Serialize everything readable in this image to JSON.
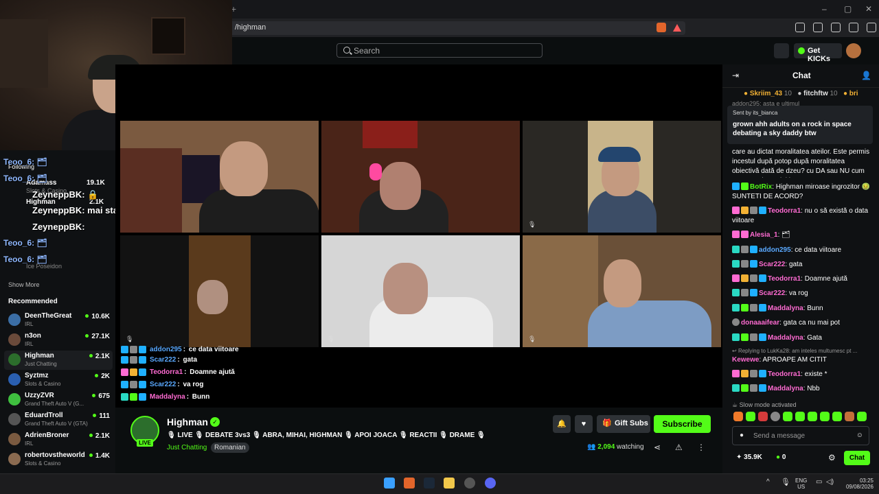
{
  "browser": {
    "tab_plus": "+",
    "url": "/highman",
    "window_controls": [
      "–",
      "▢",
      "✕"
    ]
  },
  "nav": {
    "search_placeholder": "Search",
    "get_kicks": "Get KICKs"
  },
  "stream_overlay_chat_left": [
    {
      "text": "Teoo_6: 🗂",
      "style": "blue"
    },
    {
      "text": "Teoo_6: 🗂",
      "style": "blue"
    },
    {
      "text": "ZeyneppBK: 🔒",
      "style": "big"
    },
    {
      "text": "ZeyneppBK: mai stai?",
      "style": "big"
    },
    {
      "text": "ZeyneppBK:",
      "style": "big"
    },
    {
      "text": "Teoo_6: 🗂",
      "style": "blue"
    },
    {
      "text": "Teoo_6: 🗂",
      "style": "blue"
    }
  ],
  "sidebar": {
    "following_label": "Following",
    "following_items": [
      {
        "name": "Adamass",
        "game": "Slots & Casino",
        "viewers": "19.1K"
      },
      {
        "name": "Highman",
        "game": "",
        "viewers": "2.1K"
      },
      {
        "name": "Ice Poseidon",
        "game": "",
        "viewers": ""
      }
    ],
    "show_more": "Show More",
    "recommended_label": "Recommended",
    "recommended": [
      {
        "name": "DeenTheGreat",
        "game": "IRL",
        "viewers": "10.6K",
        "color": "#3b6ea5"
      },
      {
        "name": "n3on",
        "game": "IRL",
        "viewers": "27.1K",
        "color": "#6a4a3a"
      },
      {
        "name": "Highman",
        "game": "Just Chatting",
        "viewers": "2.1K",
        "color": "#2c6e2c"
      },
      {
        "name": "Syztmz",
        "game": "Slots & Casino",
        "viewers": "2K",
        "color": "#2a5fb0"
      },
      {
        "name": "UzzyZVR",
        "game": "Grand Theft Auto V (G...",
        "viewers": "675",
        "color": "#3fbf3f"
      },
      {
        "name": "EduardTroll",
        "game": "Grand Theft Auto V (GTA)",
        "viewers": "111",
        "color": "#555"
      },
      {
        "name": "AdrienBroner",
        "game": "IRL",
        "viewers": "2.1K",
        "color": "#7a5a40"
      },
      {
        "name": "robertovstheworld",
        "game": "Slots & Casino",
        "viewers": "1.4K",
        "color": "#8a6a50"
      }
    ]
  },
  "video_chat_overlay": [
    {
      "name": "addon295",
      "msg": "ce data viitoare",
      "color": "#5aa9ff"
    },
    {
      "name": "Scar222",
      "msg": "gata",
      "color": "#5aa9ff"
    },
    {
      "name": "Teodorra1",
      "msg": "Doamne ajută",
      "color": "#ff6bd2"
    },
    {
      "name": "Scar222",
      "msg": "va rog",
      "color": "#5aa9ff"
    },
    {
      "name": "Maddalyna",
      "msg": "Bunn",
      "color": "#ff6bd2"
    }
  ],
  "channel": {
    "name": "Highman",
    "live": "LIVE",
    "title": "🎙 LIVE 🎙 DEBATE 3vs3 🎙 ABRA, MIHAI, HIGHMAN 🎙 APOI JOACA 🎙 REACTII 🎙 DRAME 🎙",
    "category": "Just Chatting",
    "language": "Romanian",
    "gift_subs": "Gift Subs",
    "subscribe": "Subscribe",
    "viewers": "2,094",
    "watching_label": "watching"
  },
  "chat": {
    "title": "Chat",
    "leaderboard": [
      {
        "name": "Skriim_43",
        "count": "10"
      },
      {
        "name": "fitchftw",
        "count": "10"
      },
      {
        "name": "bri",
        "count": ""
      }
    ],
    "behind_pinned": "addon295: asta e ultimul",
    "pinned_by": "Sent by its_bianca",
    "pinned_msg": "grown ahh adults on a rock in space debating a sky daddy btw",
    "messages": [
      {
        "name": "",
        "msg": "care au dictat moralitatea ateilor. Este permis incestul după potop după moralitatea obiectivă dată de dzeu? cu DA sau NU cum cu cerut și creștini i",
        "color": "#fff"
      },
      {
        "name": "BotRix",
        "msg": "Highman miroase ingrozitor 🤢 SUNTETI DE ACORD?",
        "color": "#53fc18"
      },
      {
        "name": "Teodorra1",
        "msg": "nu o să există o data viitoare",
        "color": "#ff6bd2"
      },
      {
        "name": "Alesia_1",
        "msg": "🗂",
        "color": "#ff6bd2"
      },
      {
        "name": "addon295",
        "msg": "ce data viitoare",
        "color": "#5aa9ff"
      },
      {
        "name": "Scar222",
        "msg": "gata",
        "color": "#ff6bd2"
      },
      {
        "name": "Teodorra1",
        "msg": "Doamne ajută",
        "color": "#ff6bd2"
      },
      {
        "name": "Scar222",
        "msg": "va rog",
        "color": "#ff6bd2"
      },
      {
        "name": "Maddalyna",
        "msg": "Bunn",
        "color": "#ff6bd2"
      },
      {
        "name": "donaaaifear",
        "msg": "gata ca nu mai pot",
        "color": "#ff6bd2"
      },
      {
        "name": "Maddalyna",
        "msg": "Gata",
        "color": "#ff6bd2"
      },
      {
        "name": "Kewewe",
        "msg": "APROAPE AM CITIT",
        "color": "#ff6bd2"
      },
      {
        "name": "Teodorra1",
        "msg": "existe *",
        "color": "#ff6bd2"
      },
      {
        "name": "Maddalyna",
        "msg": "Nbb",
        "color": "#ff6bd2"
      }
    ],
    "reply_note": "Replying to LukKa28: am inteles multumesc pt ...",
    "slow_mode": "Slow mode activated",
    "input_placeholder": "Send a message",
    "kicks_count": "35.9K",
    "points": "0",
    "send_button": "Chat"
  },
  "taskbar": {
    "lang": "ENG",
    "region": "US",
    "time": "03:25",
    "date": "09/08/2026"
  },
  "colors": {
    "accent": "#53fc18",
    "background": "#0b0e0f"
  }
}
